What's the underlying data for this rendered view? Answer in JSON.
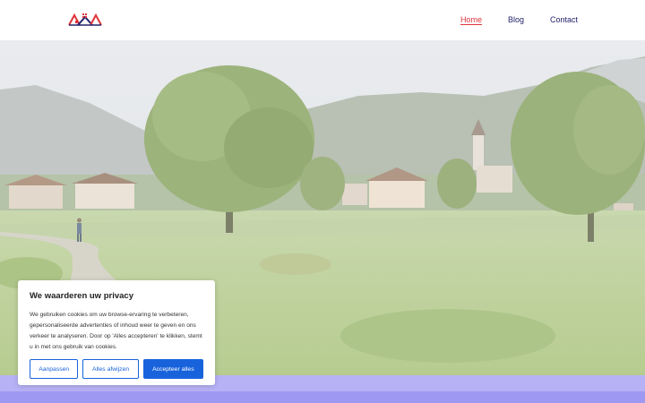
{
  "nav": {
    "items": [
      {
        "label": "Home",
        "active": true
      },
      {
        "label": "Blog",
        "active": false
      },
      {
        "label": "Contact",
        "active": false
      }
    ]
  },
  "logo": {
    "icon": "house-roofs-logo-icon",
    "colors": [
      "#e0343a",
      "#23236b"
    ]
  },
  "hero": {
    "image": "alpine-village-meadow-photo"
  },
  "cookie": {
    "title": "We waarderen uw privacy",
    "text": "We gebruiken cookies om uw browse-ervaring te verbeteren, gepersonaliseerde advertenties of inhoud weer te geven en ons verkeer te analyseren. Door op 'Alles accepteren' te klikken, stemt u in met ons gebruik van cookies.",
    "customize_label": "Aanpassen",
    "reject_label": "Alles afwijzen",
    "accept_label": "Accepteer alles",
    "accent_color": "#1863dc"
  }
}
